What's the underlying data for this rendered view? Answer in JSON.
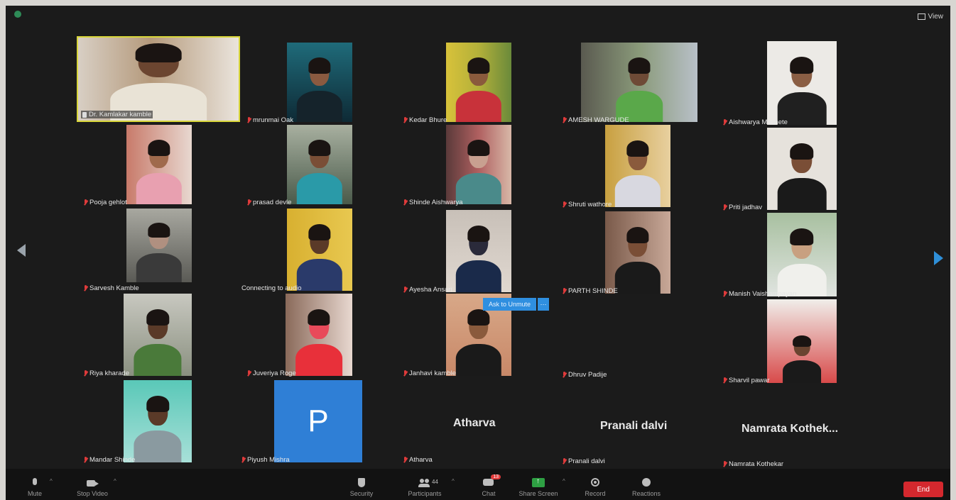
{
  "view_label": "View",
  "host": {
    "name": "Dr. Kamlakar kamble"
  },
  "participants": [
    {
      "name": "mrunmai Oak"
    },
    {
      "name": "Kedar Bhure"
    },
    {
      "name": "AMESH WARGUDE"
    },
    {
      "name": "Aishwarya Mashete"
    },
    {
      "name": "Pooja gehlot"
    },
    {
      "name": "prasad devle"
    },
    {
      "name": "Shinde Aishwarya"
    },
    {
      "name": "Shruti wathore"
    },
    {
      "name": "Priti jadhav"
    },
    {
      "name": "Sarvesh Kamble"
    },
    {
      "name": "Connecting to audio"
    },
    {
      "name": "Ayesha Ansari"
    },
    {
      "name": "PARTH SHINDE"
    },
    {
      "name": "Manish Vaishampayan"
    },
    {
      "name": "Riya kharade"
    },
    {
      "name": "Juveriya Roge"
    },
    {
      "name": "Janhavi kamble"
    },
    {
      "name": "Dhruv Padije"
    },
    {
      "name": "Sharvil pawar"
    },
    {
      "name": "Mandar Shinde"
    },
    {
      "name": "Piyush Mishra"
    },
    {
      "name": "Atharva",
      "display": "Atharva"
    },
    {
      "name": "Pranali dalvi",
      "display": "Pranali dalvi"
    },
    {
      "name": "Namrata Kothekar",
      "display": "Namrata  Kothek..."
    }
  ],
  "avatar_letter": "P",
  "ask_to_unmute": "Ask to Unmute",
  "ask_more": "···",
  "toolbar": {
    "mute": "Mute",
    "stop_video": "Stop Video",
    "security": "Security",
    "participants": "Participants",
    "participant_count": "44",
    "chat": "Chat",
    "chat_badge": "13",
    "share_screen": "Share Screen",
    "record": "Record",
    "reactions": "Reactions",
    "end": "End"
  }
}
